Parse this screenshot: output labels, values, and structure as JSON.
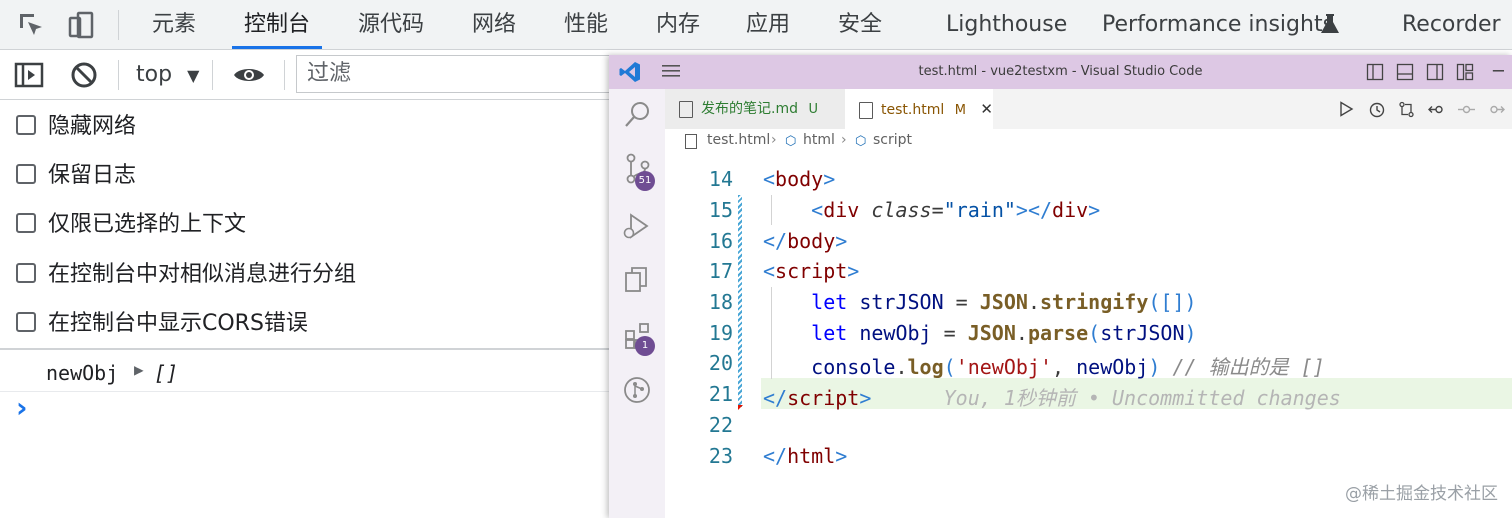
{
  "devtools": {
    "tabs": [
      {
        "label": "元素"
      },
      {
        "label": "控制台",
        "active": true
      },
      {
        "label": "源代码"
      },
      {
        "label": "网络"
      },
      {
        "label": "性能"
      },
      {
        "label": "内存"
      },
      {
        "label": "应用"
      },
      {
        "label": "安全"
      },
      {
        "label": "Lighthouse"
      },
      {
        "label": "Performance insights"
      },
      {
        "label": "Recorder"
      }
    ],
    "accent_color": "#1a73e8"
  },
  "console_toolbar": {
    "context": "top",
    "filter_placeholder": "过滤"
  },
  "settings": [
    {
      "label": "隐藏网络",
      "checked": false
    },
    {
      "label": "保留日志",
      "checked": false
    },
    {
      "label": "仅限已选择的上下文",
      "checked": false
    },
    {
      "label": "在控制台中对相似消息进行分组",
      "checked": false
    },
    {
      "label": "在控制台中显示CORS错误",
      "checked": false
    }
  ],
  "console_output": {
    "log_label": "newObj",
    "log_value": "[]",
    "prompt": "›"
  },
  "vscode": {
    "title": "test.html - vue2testxm - Visual Studio Code",
    "title_bar_color": "#ddc8e4",
    "badges": {
      "source_control": "51",
      "extensions": "1"
    },
    "tabs": [
      {
        "label": "发布的笔记.md",
        "status": "U"
      },
      {
        "label": "test.html",
        "status": "M",
        "active": true
      }
    ],
    "breadcrumb": [
      "test.html",
      "html",
      "script"
    ],
    "lines": [
      {
        "num": "14"
      },
      {
        "num": "15"
      },
      {
        "num": "16"
      },
      {
        "num": "17"
      },
      {
        "num": "18"
      },
      {
        "num": "19"
      },
      {
        "num": "20"
      },
      {
        "num": "21"
      },
      {
        "num": "22"
      },
      {
        "num": "23"
      }
    ],
    "code": {
      "l14": {
        "open": "<",
        "tag": "body",
        "close": ">"
      },
      "l15": {
        "t1": "<",
        "tag": "div",
        "attr": "class",
        "eq": "=",
        "val": "\"rain\"",
        "t2": "></",
        "tag2": "div",
        "t3": ">"
      },
      "l16": {
        "open": "</",
        "tag": "body",
        "close": ">"
      },
      "l17": {
        "open": "<",
        "tag": "script",
        "close": ">"
      },
      "l18": {
        "kw": "let",
        "var": "strJSON",
        "eq": " = ",
        "obj": "JSON",
        "dot": ".",
        "fn": "stringify",
        "args": "([])"
      },
      "l19": {
        "kw": "let",
        "var": "newObj",
        "eq": " = ",
        "obj": "JSON",
        "dot": ".",
        "fn": "parse",
        "args_open": "(",
        "arg": "strJSON",
        "args_close": ")"
      },
      "l20": {
        "obj": "console",
        "dot": ".",
        "fn": "log",
        "p1": "(",
        "str": "'newObj'",
        "comma": ", ",
        "arg": "newObj",
        "p2": ")",
        "comment": "// 输出的是 []"
      },
      "l21": {
        "open": "</",
        "tag": "script",
        "close": ">",
        "blame": "You, 1秒钟前 • Uncommitted changes"
      },
      "l23": {
        "open": "</",
        "tag": "html",
        "close": ">"
      }
    }
  },
  "watermark": "@稀土掘金技术社区"
}
